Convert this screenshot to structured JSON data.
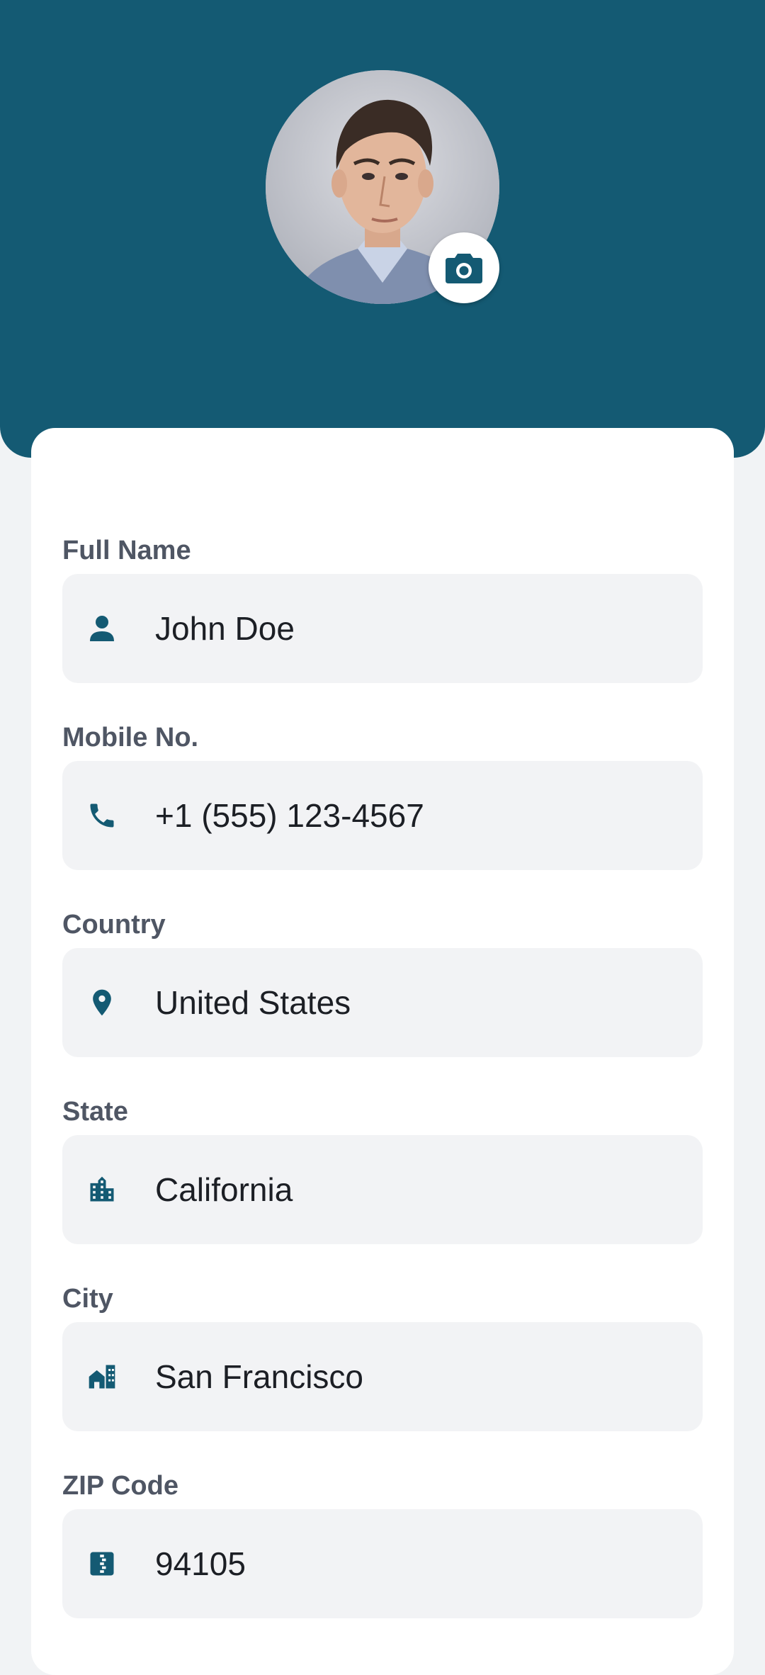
{
  "theme": {
    "header_color": "#145a73",
    "accent_color": "#145a73",
    "background_color": "#f1f3f5",
    "field_background": "#f2f3f5"
  },
  "profile": {
    "avatar_alt": "Profile photo",
    "camera_icon": "camera-icon"
  },
  "fields": [
    {
      "label": "Full Name",
      "value": "John Doe",
      "icon": "person-icon"
    },
    {
      "label": "Mobile No.",
      "value": "+1 (555) 123-4567",
      "icon": "phone-icon"
    },
    {
      "label": "Country",
      "value": "United States",
      "icon": "location-pin-icon"
    },
    {
      "label": "State",
      "value": "California",
      "icon": "city-icon"
    },
    {
      "label": "City",
      "value": "San Francisco",
      "icon": "buildings-icon"
    },
    {
      "label": "ZIP Code",
      "value": "94105",
      "icon": "zip-code-icon"
    }
  ]
}
